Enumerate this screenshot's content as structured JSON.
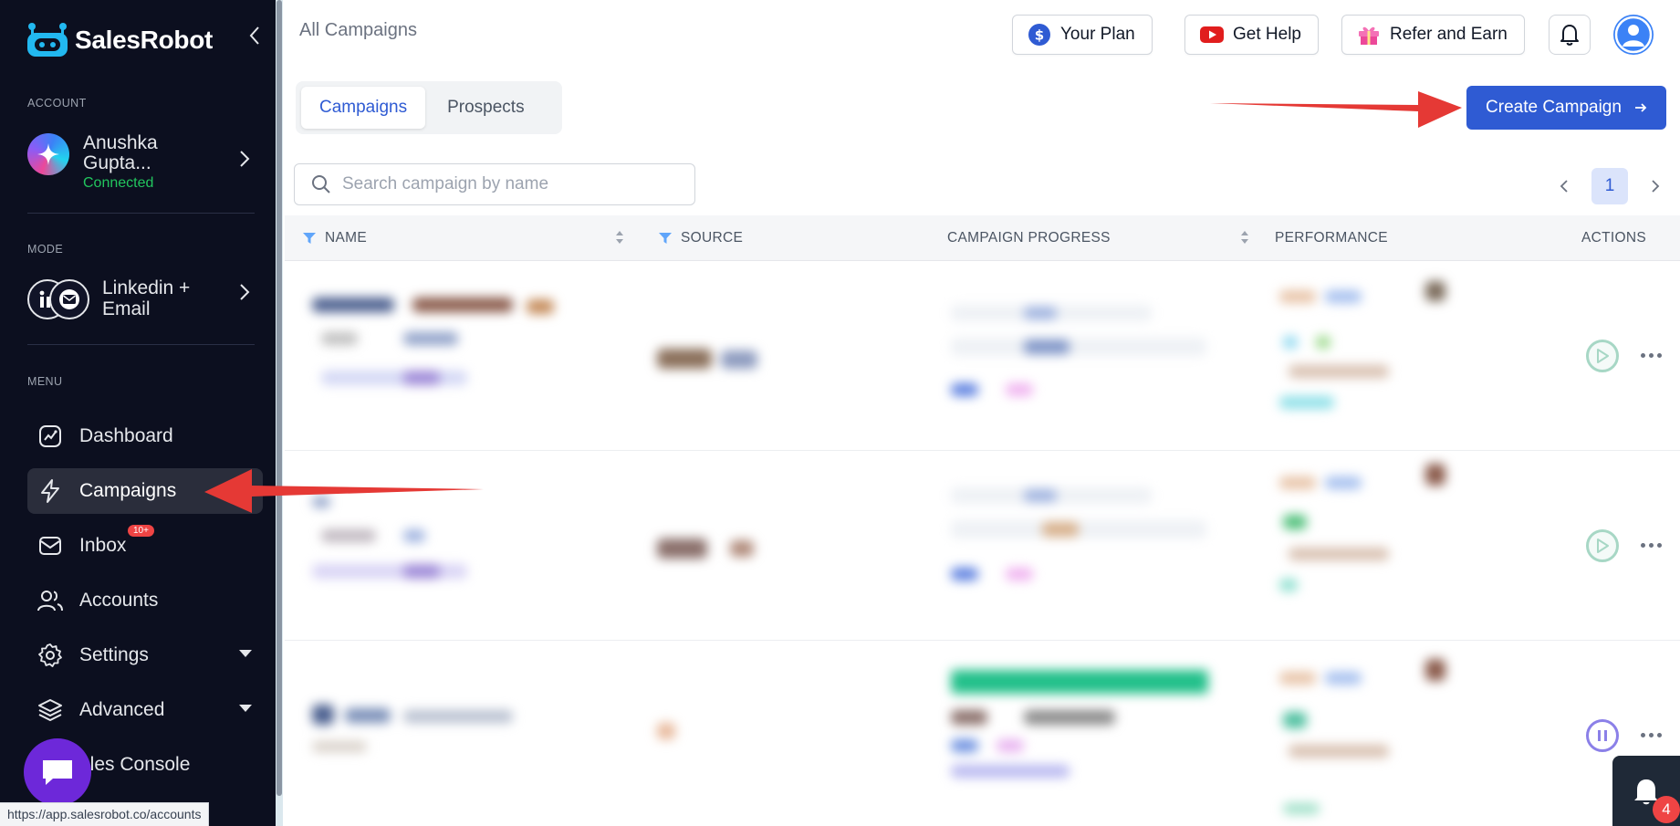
{
  "sidebar": {
    "brand": "SalesRobot",
    "account_section": "ACCOUNT",
    "account_name": "Anushka Gupta...",
    "account_status": "Connected",
    "mode_section": "MODE",
    "mode_label": "Linkedin + Email",
    "menu_section": "MENU",
    "items": [
      {
        "label": "Dashboard",
        "icon": "dashboard-icon"
      },
      {
        "label": "Campaigns",
        "icon": "lightning-icon",
        "active": true
      },
      {
        "label": "Inbox",
        "icon": "mail-icon",
        "badge": "10+"
      },
      {
        "label": "Accounts",
        "icon": "users-icon"
      },
      {
        "label": "Settings",
        "icon": "gear-icon"
      },
      {
        "label": "Advanced",
        "icon": "layers-icon"
      },
      {
        "label": "ales Console",
        "icon": "console-icon"
      }
    ]
  },
  "status_bar": {
    "url": "https://app.salesrobot.co/accounts"
  },
  "header": {
    "title": "All Campaigns",
    "your_plan": "Your Plan",
    "get_help": "Get Help",
    "refer": "Refer and Earn"
  },
  "tabs": [
    {
      "label": "Campaigns",
      "active": true
    },
    {
      "label": "Prospects",
      "active": false
    }
  ],
  "create_campaign": "Create Campaign",
  "search": {
    "placeholder": "Search campaign by name",
    "value": ""
  },
  "pagination": {
    "current": "1"
  },
  "table": {
    "columns": [
      "NAME",
      "SOURCE",
      "CAMPAIGN PROGRESS",
      "PERFORMANCE",
      "ACTIONS"
    ],
    "rows": [
      {
        "action": "play"
      },
      {
        "action": "play"
      },
      {
        "action": "pause"
      }
    ]
  },
  "notifications": {
    "count": "4"
  },
  "colors": {
    "sidebar_bg": "#0c0f1f",
    "primary": "#2f5bd3",
    "connected": "#22c55e",
    "annotation_arrow": "#e53935"
  }
}
